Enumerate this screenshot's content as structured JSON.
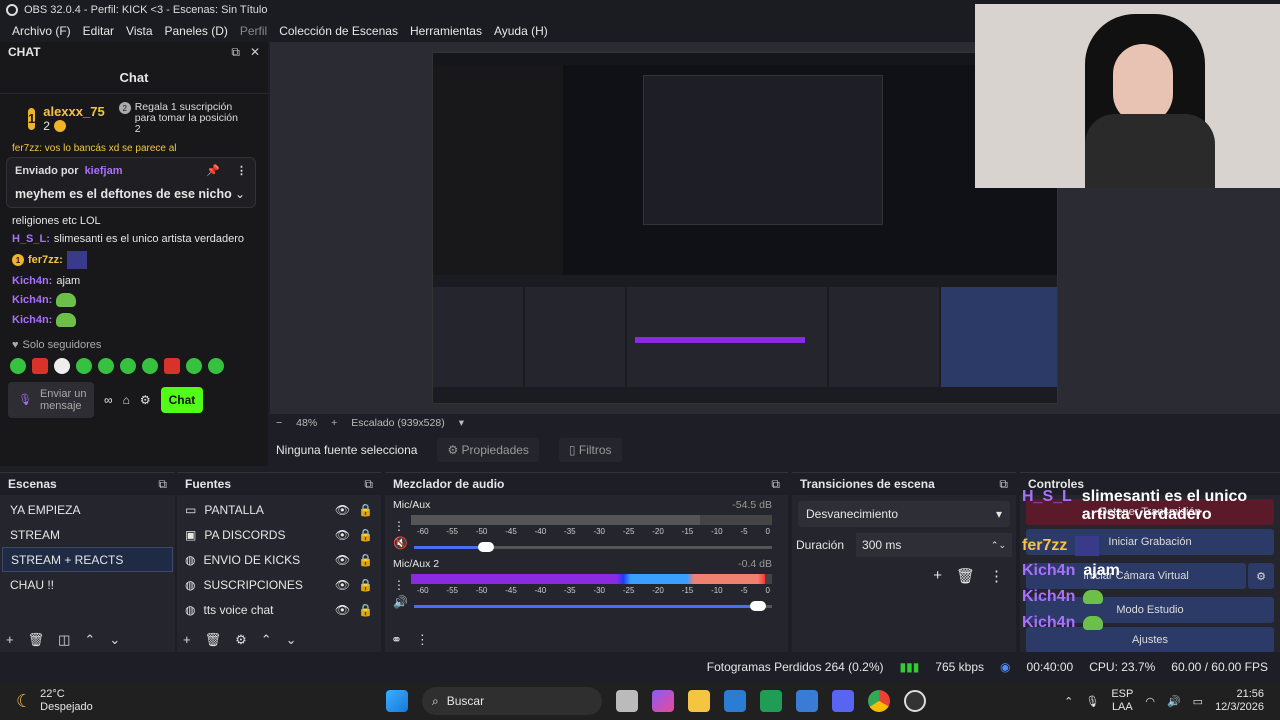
{
  "window": {
    "title": "OBS 32.0.4 - Perfil: KICK <3 - Escenas: Sin Título"
  },
  "menu": [
    "Archivo (F)",
    "Editar",
    "Vista",
    "Paneles (D)",
    "Perfil",
    "Colección de Escenas",
    "Herramientas",
    "Ayuda (H)"
  ],
  "chat": {
    "dock_title": "CHAT",
    "title": "Chat",
    "leader": {
      "rank": "1",
      "name": "alexxx_75",
      "count": "2",
      "gift_rank": "2",
      "gift_text": "Regala 1 suscripción para tomar la posición 2"
    },
    "partial_line": "fer7zz: vos lo bancás xd se parece al",
    "pinned": {
      "label": "Enviado por",
      "user": "kiefjam",
      "message": "meyhem es el deftones de ese nicho"
    },
    "messages": [
      {
        "user": "",
        "text": "religiones etc LOL",
        "color": "#e6e6e6"
      },
      {
        "user": "H_S_L:",
        "text": "slimesanti es el unico artista verdadero",
        "color": "#a970ff"
      },
      {
        "user": "fer7zz:",
        "text": "",
        "color": "#f5c542"
      },
      {
        "user": "Kich4n:",
        "text": "ajam",
        "color": "#a970ff"
      },
      {
        "user": "Kich4n:",
        "text": "",
        "color": "#a970ff"
      },
      {
        "user": "Kich4n:",
        "text": "",
        "color": "#a970ff"
      }
    ],
    "followers_only": "Solo seguidores",
    "input_placeholder": "Enviar un mensaje",
    "send_label": "Chat"
  },
  "preview": {
    "zoom": "48%",
    "scale": "Escalado (939x528)"
  },
  "context": {
    "no_source": "Ninguna fuente selecciona",
    "properties": "Propiedades",
    "filters": "Filtros"
  },
  "scenes": {
    "title": "Escenas",
    "items": [
      "YA EMPIEZA",
      "STREAM",
      "STREAM + REACTS",
      "CHAU !!"
    ],
    "selected": 2
  },
  "sources": {
    "title": "Fuentes",
    "items": [
      "PANTALLA",
      "PA DISCORDS",
      "ENVIO DE KICKS",
      "SUSCRIPCIONES",
      "tts voice chat"
    ]
  },
  "mixer": {
    "title": "Mezclador de audio",
    "channels": [
      {
        "name": "Mic/Aux",
        "db": "-54.5 dB",
        "level": 0.0,
        "volume": 0.2
      },
      {
        "name": "Mic/Aux 2",
        "db": "-0.4 dB",
        "level": 0.98,
        "volume": 0.96
      }
    ],
    "ticks": [
      "-60",
      "-55",
      "-50",
      "-45",
      "-40",
      "-35",
      "-30",
      "-25",
      "-20",
      "-15",
      "-10",
      "-5",
      "0"
    ]
  },
  "transitions": {
    "title": "Transiciones de escena",
    "type": "Desvanecimiento",
    "duration_label": "Duración",
    "duration": "300 ms"
  },
  "controls": {
    "title": "Controles",
    "buttons": [
      "Detener Transmisión",
      "Iniciar Grabación",
      "Iniciar Cámara Virtual",
      "Modo Estudio",
      "Ajustes"
    ],
    "overlay": [
      {
        "user": "H_S_L",
        "text": "slimesanti es el unico artista verdadero",
        "color": "#a970ff"
      },
      {
        "user": "fer7zz",
        "text": "",
        "color": "#f5c542"
      },
      {
        "user": "Kich4n",
        "text": "ajam",
        "color": "#a970ff"
      },
      {
        "user": "Kich4n",
        "text": "",
        "color": "#a970ff"
      },
      {
        "user": "Kich4n",
        "text": "",
        "color": "#a970ff"
      }
    ]
  },
  "status": {
    "dropped": "Fotogramas Perdidos 264 (0.2%)",
    "bitrate": "765 kbps",
    "rec_time": "00:40:00",
    "cpu": "CPU: 23.7%",
    "fps": "60.00 / 60.00 FPS"
  },
  "taskbar": {
    "temp": "22°C",
    "weather": "Despejado",
    "search": "Buscar",
    "lang1": "ESP",
    "lang2": "LAA",
    "time": "21:56",
    "date": "12/3/2026"
  }
}
